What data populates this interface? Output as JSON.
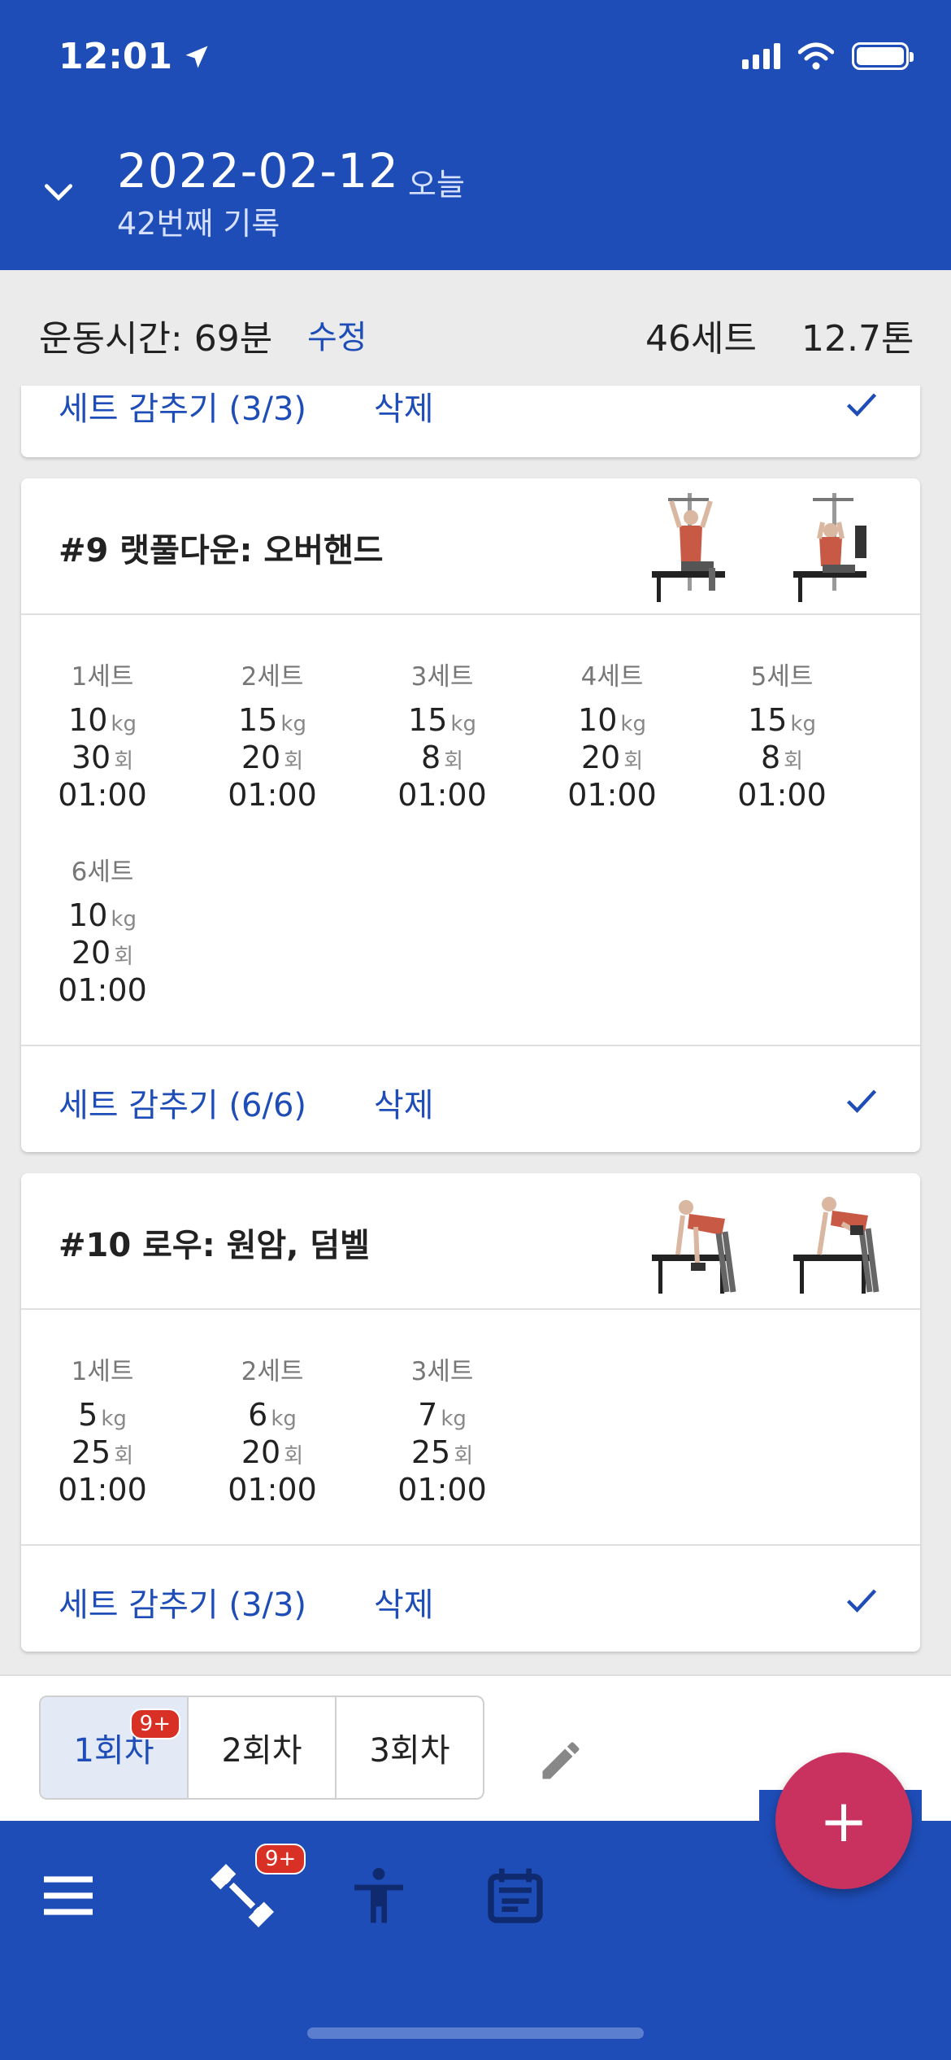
{
  "status": {
    "time": "12:01"
  },
  "header": {
    "date": "2022-02-12",
    "today": "오늘",
    "record": "42번째 기록"
  },
  "summary": {
    "workout_time": "운동시간: 69분",
    "edit": "수정",
    "sets": "46세트",
    "tons": "12.7톤"
  },
  "top_card": {
    "hide": "세트 감추기 (3/3)",
    "delete": "삭제"
  },
  "exercises": [
    {
      "title": "#9 랫풀다운: 오버핸드",
      "sets": [
        {
          "label": "1세트",
          "kg": "10",
          "reps": "30",
          "time": "01:00"
        },
        {
          "label": "2세트",
          "kg": "15",
          "reps": "20",
          "time": "01:00"
        },
        {
          "label": "3세트",
          "kg": "15",
          "reps": "8",
          "time": "01:00"
        },
        {
          "label": "4세트",
          "kg": "10",
          "reps": "20",
          "time": "01:00"
        },
        {
          "label": "5세트",
          "kg": "15",
          "reps": "8",
          "time": "01:00"
        },
        {
          "label": "6세트",
          "kg": "10",
          "reps": "20",
          "time": "01:00"
        }
      ],
      "hide": "세트 감추기 (6/6)",
      "delete": "삭제"
    },
    {
      "title": "#10 로우: 원암, 덤벨",
      "sets": [
        {
          "label": "1세트",
          "kg": "5",
          "reps": "25",
          "time": "01:00"
        },
        {
          "label": "2세트",
          "kg": "6",
          "reps": "20",
          "time": "01:00"
        },
        {
          "label": "3세트",
          "kg": "7",
          "reps": "25",
          "time": "01:00"
        }
      ],
      "hide": "세트 감추기 (3/3)",
      "delete": "삭제"
    }
  ],
  "units": {
    "kg": "kg",
    "reps": "회"
  },
  "sessions": {
    "tabs": [
      "1회차",
      "2회차",
      "3회차"
    ],
    "badge": "9+"
  },
  "nav": {
    "badge": "9+",
    "fab": "+"
  },
  "colors": {
    "brand": "#1e4db7",
    "fab": "#c9325f",
    "badge": "#d93025"
  }
}
